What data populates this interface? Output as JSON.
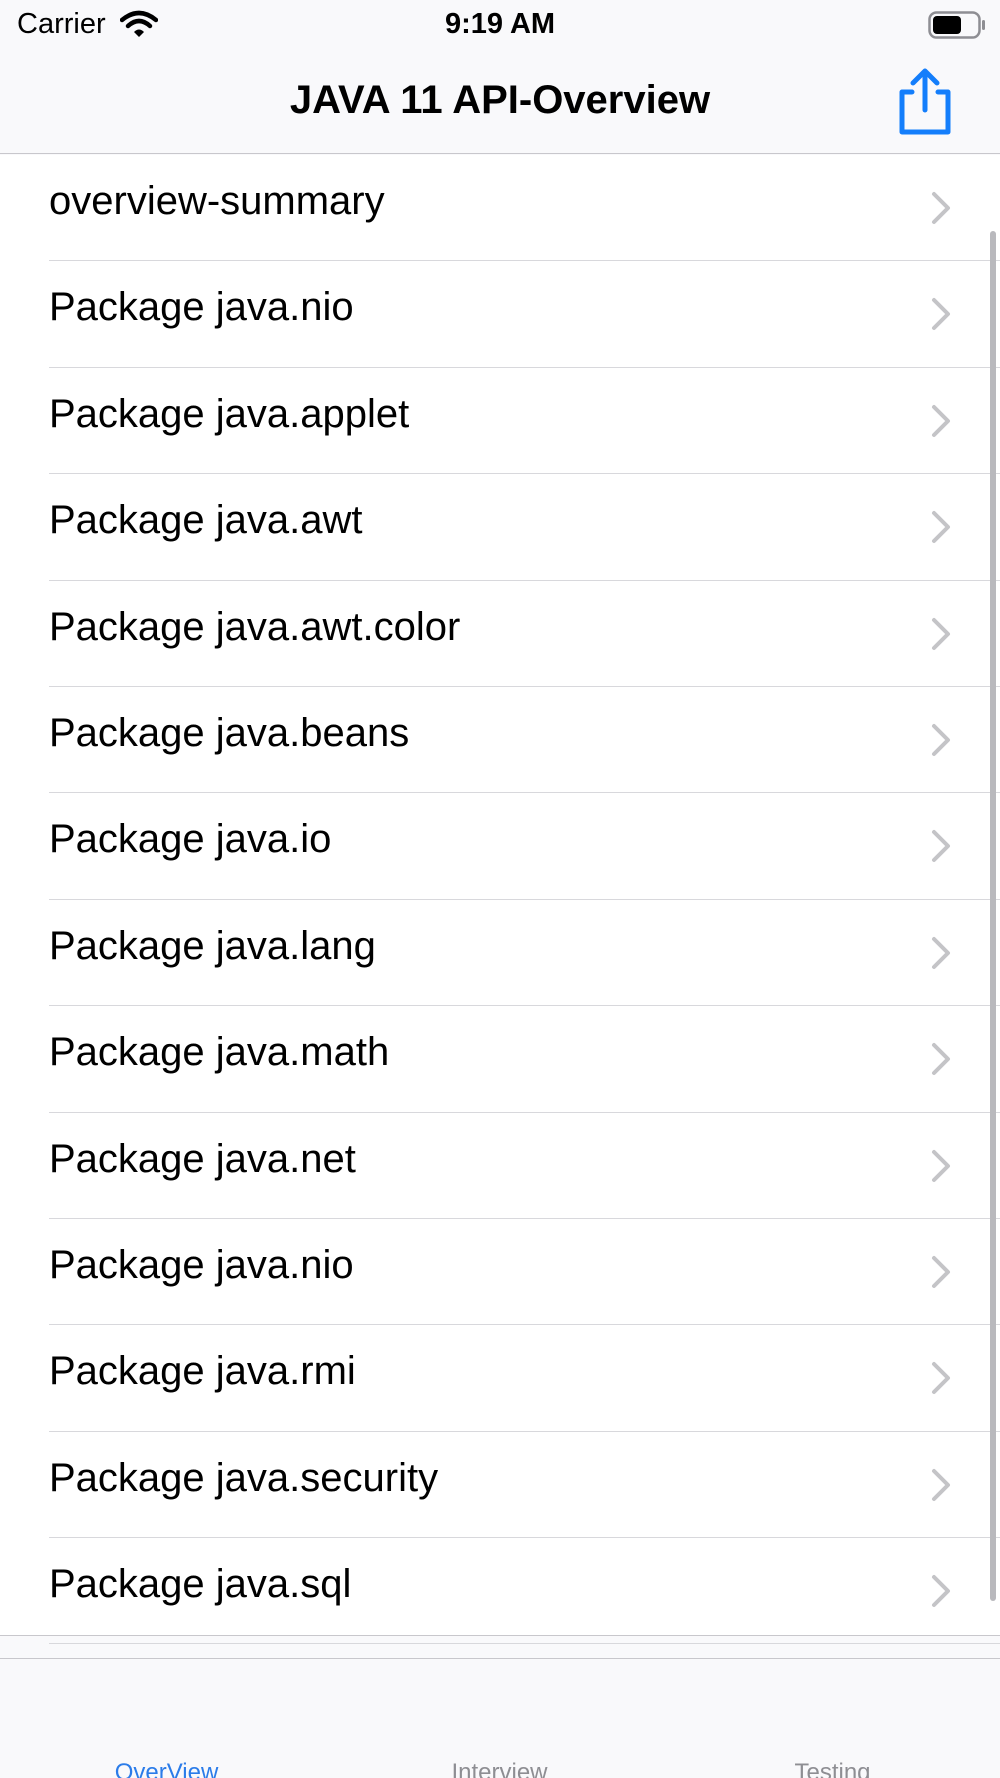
{
  "status_bar": {
    "carrier": "Carrier",
    "time": "9:19 AM"
  },
  "nav": {
    "title": "JAVA 11 API-Overview",
    "share_icon": "share-icon"
  },
  "list": {
    "items": [
      {
        "label": "overview-summary"
      },
      {
        "label": "Package java.nio"
      },
      {
        "label": "Package java.applet"
      },
      {
        "label": "Package java.awt"
      },
      {
        "label": "Package java.awt.color"
      },
      {
        "label": "Package java.beans"
      },
      {
        "label": "Package java.io"
      },
      {
        "label": "Package java.lang"
      },
      {
        "label": "Package java.math"
      },
      {
        "label": "Package java.net"
      },
      {
        "label": "Package java.nio"
      },
      {
        "label": "Package java.rmi"
      },
      {
        "label": "Package java.security"
      },
      {
        "label": "Package java.sql"
      }
    ]
  },
  "tab_bar": {
    "tabs": [
      {
        "label": "OverView",
        "selected": true
      },
      {
        "label": "Interview",
        "selected": false
      },
      {
        "label": "Testing",
        "selected": false
      }
    ]
  },
  "colors": {
    "accent": "#147efb",
    "selected_tab": "#2b7ce9",
    "inactive_tab": "#8e8e93",
    "separator": "#d8d8dc",
    "chevron": "#c4c4c7"
  }
}
